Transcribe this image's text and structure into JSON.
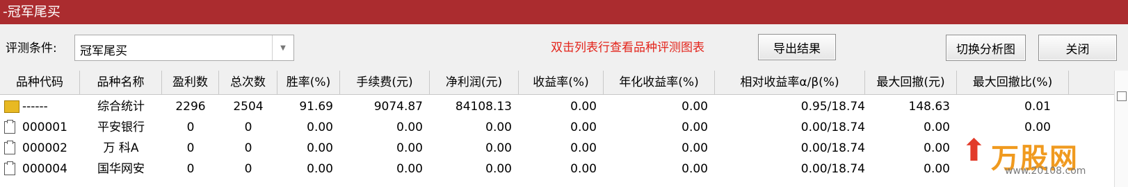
{
  "window": {
    "title": "-冠军尾买"
  },
  "toolbar": {
    "condition_label": "评测条件:",
    "condition_value": "冠军尾买",
    "hint": "双击列表行查看品种评测图表",
    "export_label": "导出结果",
    "switch_label": "切换分析图",
    "close_label": "关闭"
  },
  "columns": [
    "品种代码",
    "品种名称",
    "盈利数",
    "总次数",
    "胜率(%)",
    "手续费(元)",
    "净利润(元)",
    "收益率(%)",
    "年化收益率(%)",
    "相对收益率α/β(%)",
    "最大回撤(元)",
    "最大回撤比(%)"
  ],
  "rows": [
    {
      "icon": "summary-folder-icon",
      "code": "------",
      "name": "综合统计",
      "profit_count": "2296",
      "total_count": "2504",
      "win_rate": "91.69",
      "fee": "9074.87",
      "net_profit": "84108.13",
      "return_rate": "0.00",
      "annual_return": "0.00",
      "relative_return": "0.95/18.74",
      "max_drawdown": "148.63",
      "max_drawdown_ratio": "0.01"
    },
    {
      "icon": "document-icon",
      "code": "000001",
      "name": "平安银行",
      "profit_count": "0",
      "total_count": "0",
      "win_rate": "0.00",
      "fee": "0.00",
      "net_profit": "0.00",
      "return_rate": "0.00",
      "annual_return": "0.00",
      "relative_return": "0.00/18.74",
      "max_drawdown": "0.00",
      "max_drawdown_ratio": "0.00"
    },
    {
      "icon": "document-icon",
      "code": "000002",
      "name": "万 科A",
      "profit_count": "0",
      "total_count": "0",
      "win_rate": "0.00",
      "fee": "0.00",
      "net_profit": "0.00",
      "return_rate": "0.00",
      "annual_return": "0.00",
      "relative_return": "0.00/18.74",
      "max_drawdown": "0.00",
      "max_drawdown_ratio": ""
    },
    {
      "icon": "document-icon",
      "code": "000004",
      "name": "国华网安",
      "profit_count": "0",
      "total_count": "0",
      "win_rate": "0.00",
      "fee": "0.00",
      "net_profit": "0.00",
      "return_rate": "0.00",
      "annual_return": "0.00",
      "relative_return": "0.00/18.74",
      "max_drawdown": "0.00",
      "max_drawdown_ratio": ""
    }
  ],
  "watermark": {
    "text": "万股网",
    "url": "www.20108.com"
  },
  "colors": {
    "titlebar": "#ab2c2f",
    "hint": "#e3241b",
    "watermark_orange": "#f09a1f",
    "watermark_red": "#e23b2a"
  }
}
